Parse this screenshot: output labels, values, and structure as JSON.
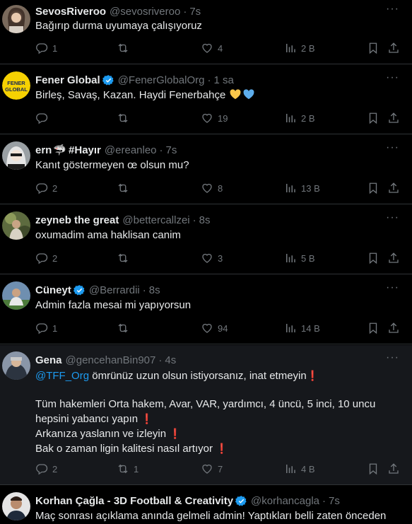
{
  "tweets": [
    {
      "name": "SevosRiveroo",
      "verified": false,
      "handle": "@sevosriveroo",
      "time": "7s",
      "text": "Bağırıp durma uyumaya çalışıyoruz",
      "replies": "1",
      "retweets": "",
      "likes": "4",
      "views": "2 B"
    },
    {
      "name": "Fener Global",
      "verified": true,
      "handle": "@FenerGlobalOrg",
      "time": "1 sa",
      "text": "Birleş, Savaş, Kazan. Haydi Fenerbahçe",
      "emoji": [
        "yellow-heart",
        "blue-heart"
      ],
      "avatar_text": [
        "FENER",
        "GLOBAL"
      ],
      "replies": "",
      "retweets": "",
      "likes": "19",
      "views": "2 B"
    },
    {
      "name": "ern",
      "name_suffix": "#Hayır",
      "name_emoji": "🦈",
      "verified": false,
      "handle": "@ereanleo",
      "time": "7s",
      "text": "Kanıt göstermeyen œ olsun mu?",
      "replies": "2",
      "retweets": "",
      "likes": "8",
      "views": "13 B"
    },
    {
      "name": "zeyneb the great",
      "verified": false,
      "handle": "@bettercallzei",
      "time": "8s",
      "text": "oxumadim ama haklisan canim",
      "replies": "2",
      "retweets": "",
      "likes": "3",
      "views": "5 B"
    },
    {
      "name": "Cüneyt",
      "verified": true,
      "handle": "@Berrardii",
      "time": "8s",
      "text": "Admin fazla mesai mi yapıyorsun",
      "replies": "1",
      "retweets": "",
      "likes": "94",
      "views": "14 B"
    },
    {
      "name": "Gena",
      "verified": false,
      "handle": "@gencehanBin907",
      "time": "4s",
      "mention": "@TFF_Org",
      "lines": [
        "ömrünüz uzun olsun istiyorsanız, inat etmeyin",
        "",
        "Tüm hakemleri Orta hakem, Avar, VAR, yardımcı, 4 üncü, 5 inci, 10 uncu",
        "hepsini yabancı yapın",
        "Arkanıza yaslanın ve izleyin",
        "Bak o zaman ligin kalitesi nasıl artıyor"
      ],
      "exclaim": "❗",
      "replies": "2",
      "retweets": "1",
      "likes": "7",
      "views": "4 B"
    },
    {
      "name": "Korhan Çağla - 3D Football & Creativity",
      "verified": true,
      "handle": "@korhancagla",
      "time": "7s",
      "text": "Maç sonrası açıklama anında gelmeli admin! Yaptıkları belli zaten önceden"
    }
  ],
  "more_label": "···",
  "colors": {
    "accent": "#1d9bf0",
    "muted": "#71767b",
    "text": "#e7e9ea",
    "bg": "#000000",
    "divider": "#2f3336",
    "fener_yellow": "#f6d102",
    "fener_navy": "#162455"
  }
}
